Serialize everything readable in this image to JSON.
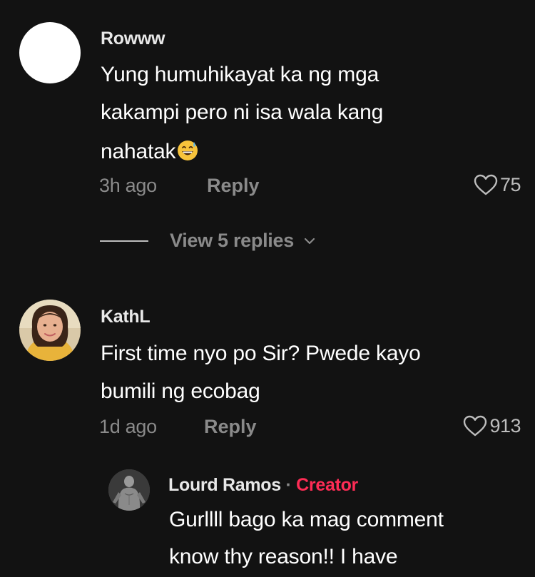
{
  "comments": [
    {
      "username": "Rowww",
      "text_lines": [
        "Yung humuhikayat ka ng mga",
        "kakampi pero ni isa wala kang",
        "nahatak"
      ],
      "emoji": "grinning-sweat-emoji",
      "time": "3h ago",
      "reply_label": "Reply",
      "likes": "75",
      "avatar": "blank-white-avatar"
    },
    {
      "username": "KathL",
      "text_lines": [
        "First time nyo po Sir? Pwede kayo",
        "bumili ng ecobag"
      ],
      "time": "1d ago",
      "reply_label": "Reply",
      "likes": "913",
      "avatar": "photo-avatar"
    }
  ],
  "view_replies": {
    "label": "View 5 replies",
    "icon": "chevron-down-icon"
  },
  "reply": {
    "username": "Lourd Ramos",
    "separator": "·",
    "badge": "Creator",
    "text_lines": [
      "Gurllll bago ka mag comment",
      "know thy reason!! I have"
    ],
    "avatar": "photo-avatar-grayscale"
  },
  "colors": {
    "background": "#121212",
    "creator_badge": "#fe2c55",
    "muted_text": "#8a8a8a"
  }
}
